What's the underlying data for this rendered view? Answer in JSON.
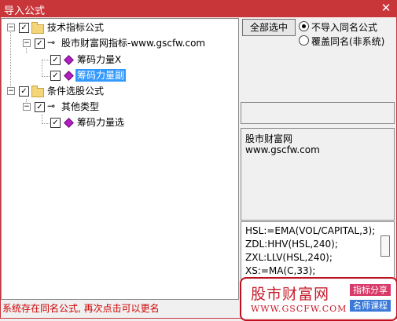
{
  "window": {
    "title": "导入公式",
    "close": "✕"
  },
  "tree": {
    "categories": [
      {
        "label": "技术指标公式",
        "group": {
          "label": "股市财富网指标-www.gscfw.com",
          "items": [
            {
              "label": "筹码力量X"
            },
            {
              "label": "筹码力量副"
            }
          ]
        }
      },
      {
        "label": "条件选股公式",
        "group": {
          "label": "其他类型",
          "items": [
            {
              "label": "筹码力量选"
            }
          ]
        }
      }
    ],
    "selected_item": "筹码力量副"
  },
  "actions": {
    "select_all": "全部选中"
  },
  "options": {
    "radio1": "不导入同名公式",
    "radio2": "覆盖同名(非系统)",
    "selected": "不导入同名公式"
  },
  "info": {
    "line1": "股市财富网",
    "line2": "www.gscfw.com"
  },
  "code": {
    "lines": [
      "HSL:=EMA(VOL/CAPITAL,3);",
      "ZDL:HHV(HSL,240);",
      "ZXL:LLV(HSL,240);",
      "XS:=MA(C,33);"
    ]
  },
  "status": "系统存在同名公式, 再次点击可以更名",
  "watermark": {
    "brand": "股市财富网",
    "url": "WWW.GSCFW.COM",
    "tag1": "指标分享",
    "tag2": "名师课程"
  }
}
